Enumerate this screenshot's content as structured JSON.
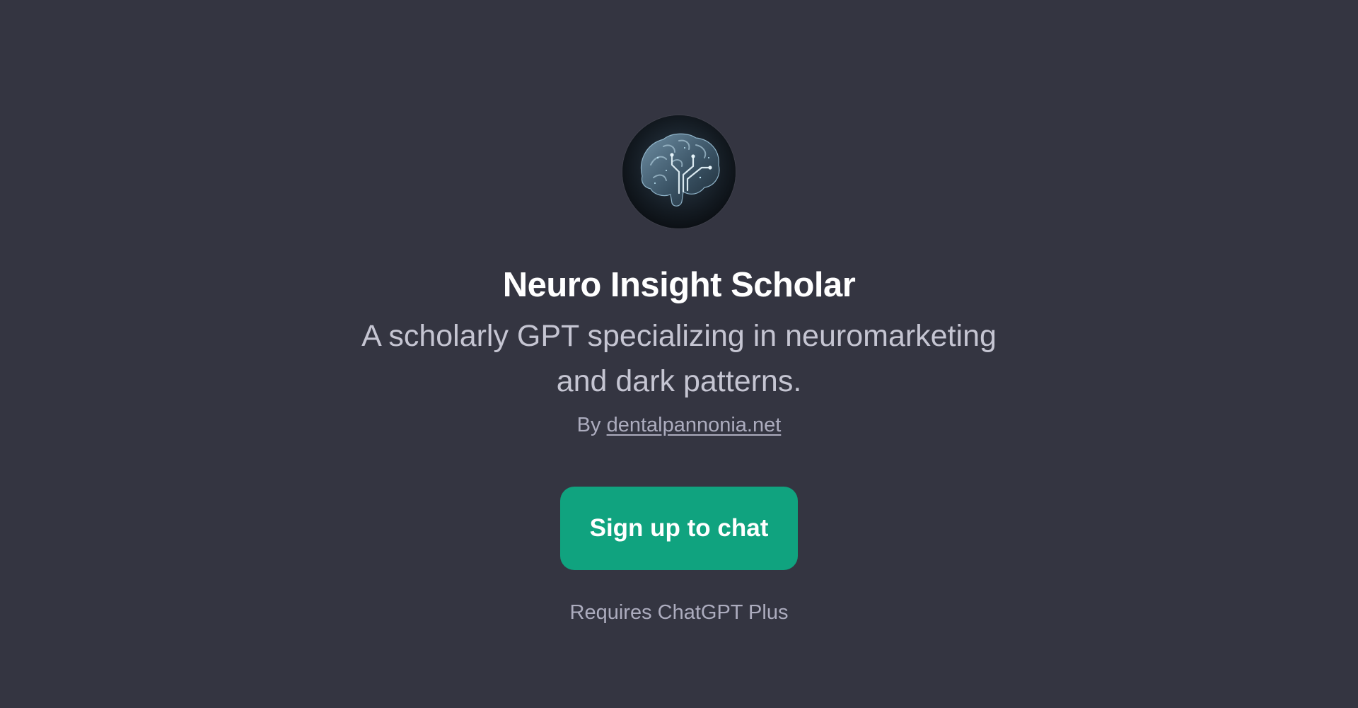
{
  "gpt": {
    "avatar_icon": "brain-circuit-icon",
    "title": "Neuro Insight Scholar",
    "description_line1": "A scholarly GPT specializing in neuromarketing",
    "description_line2": "and dark patterns.",
    "byline_prefix": "By",
    "author": "dentalpannonia.net"
  },
  "actions": {
    "signup_label": "Sign up to chat",
    "requirement": "Requires ChatGPT Plus"
  },
  "colors": {
    "background": "#343541",
    "accent": "#10a37f",
    "title": "#ffffff",
    "description": "#c5c5d2",
    "muted": "#acacbe"
  }
}
